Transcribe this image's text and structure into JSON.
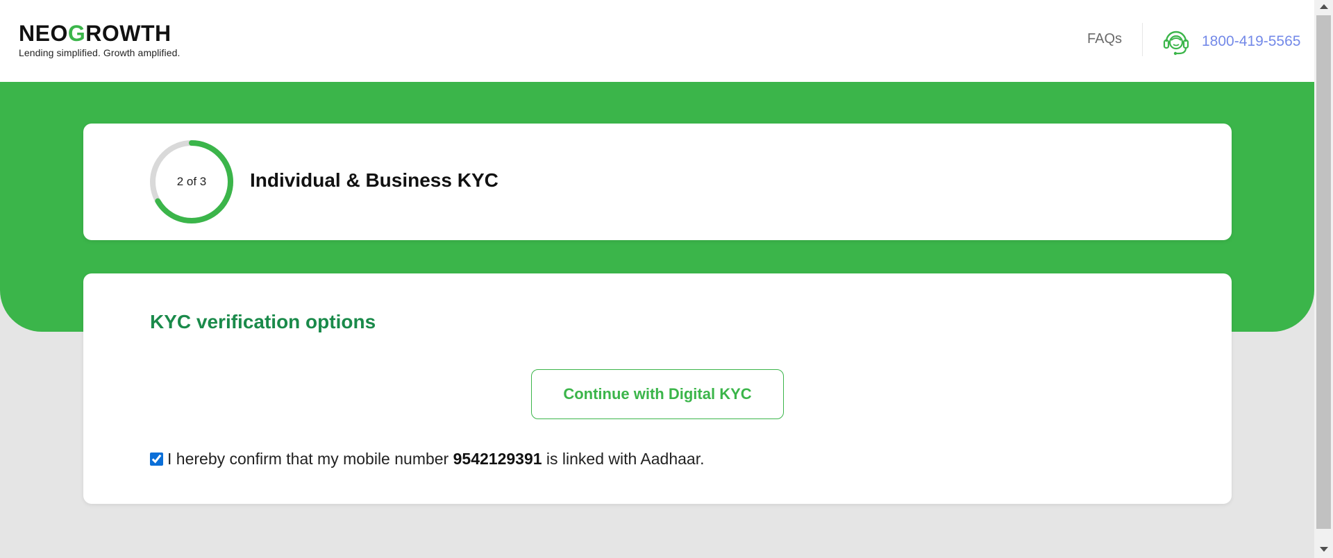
{
  "header": {
    "logo": {
      "part1": "NEO",
      "g": "G",
      "part2": "ROWTH",
      "tagline": "Lending simplified. Growth amplified."
    },
    "faq_label": "FAQs",
    "support_icon": "headset-support-icon",
    "phone": "1800-419-5565"
  },
  "steps": {
    "current": 2,
    "total": 3,
    "progress_fraction": 0.667,
    "label": "2 of 3",
    "title": "Individual & Business KYC"
  },
  "kyc": {
    "heading": "KYC verification options",
    "digital_button": "Continue with Digital KYC",
    "confirm": {
      "checked": true,
      "prefix": "I hereby confirm that my mobile number",
      "number": "9542129391",
      "suffix": "is linked with Aadhaar."
    }
  },
  "colors": {
    "brand_green": "#3bb54a",
    "heading_green": "#1a8a4a",
    "phone_blue": "#7389e8",
    "page_bg": "#e5e5e5"
  }
}
